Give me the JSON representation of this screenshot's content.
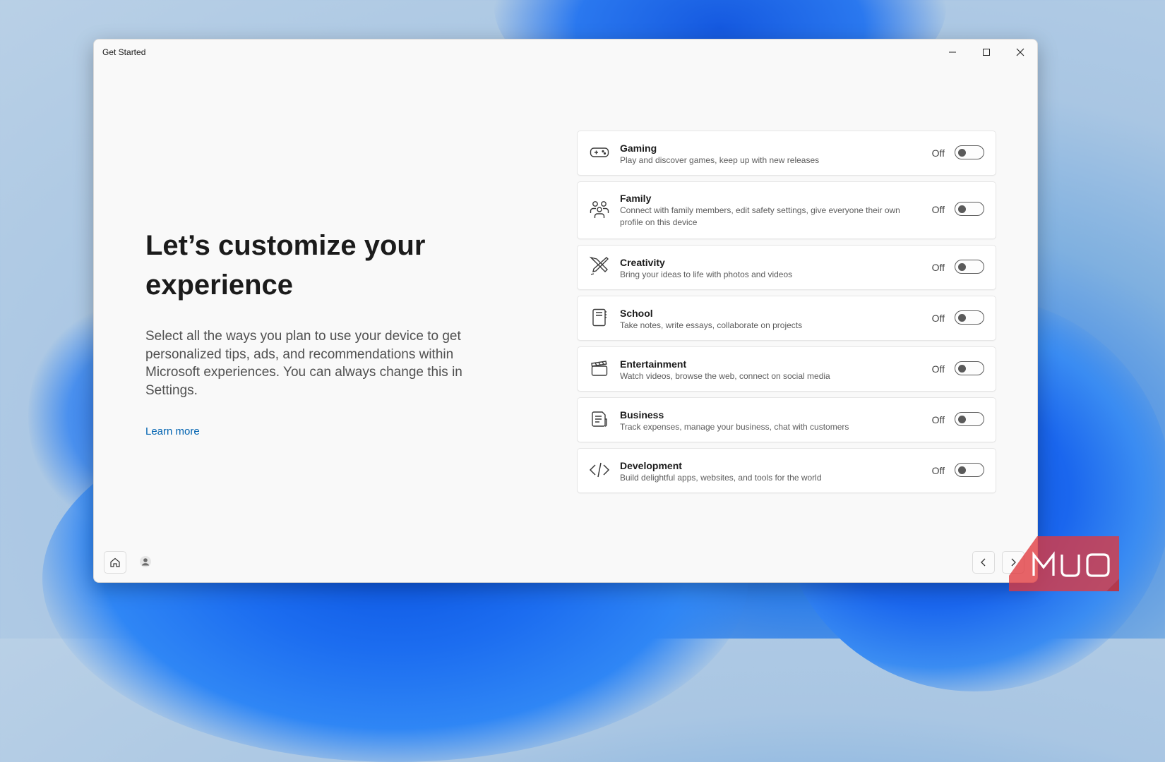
{
  "window": {
    "title": "Get Started"
  },
  "main": {
    "heading": "Let’s customize your experience",
    "description": "Select all the ways you plan to use your device to get personalized tips, ads, and recommendations within Microsoft experiences. You can always change this in Settings.",
    "learn_more": "Learn more"
  },
  "options": [
    {
      "icon": "gamepad-icon",
      "name": "Gaming",
      "description": "Play and discover games, keep up with new releases",
      "state": "Off",
      "enabled": false
    },
    {
      "icon": "family-icon",
      "name": "Family",
      "description": "Connect with family members, edit safety settings, give everyone their own profile on this device",
      "state": "Off",
      "enabled": false
    },
    {
      "icon": "creativity-icon",
      "name": "Creativity",
      "description": "Bring your ideas to life with photos and videos",
      "state": "Off",
      "enabled": false
    },
    {
      "icon": "notebook-icon",
      "name": "School",
      "description": "Take notes, write essays, collaborate on projects",
      "state": "Off",
      "enabled": false
    },
    {
      "icon": "clapperboard-icon",
      "name": "Entertainment",
      "description": "Watch videos, browse the web, connect on social media",
      "state": "Off",
      "enabled": false
    },
    {
      "icon": "document-icon",
      "name": "Business",
      "description": "Track expenses, manage your business, chat with customers",
      "state": "Off",
      "enabled": false
    },
    {
      "icon": "code-icon",
      "name": "Development",
      "description": "Build delightful apps, websites, and tools for the world",
      "state": "Off",
      "enabled": false
    }
  ],
  "footer": {
    "left_icons": [
      "home-icon",
      "person-icon"
    ],
    "nav_icons": [
      "chevron-left-icon",
      "chevron-right-icon"
    ]
  },
  "watermark": {
    "text": "MUO",
    "color": "#e0393e"
  },
  "colors": {
    "accent": "#0063b1",
    "wallpaper": "#1f6fe6"
  }
}
